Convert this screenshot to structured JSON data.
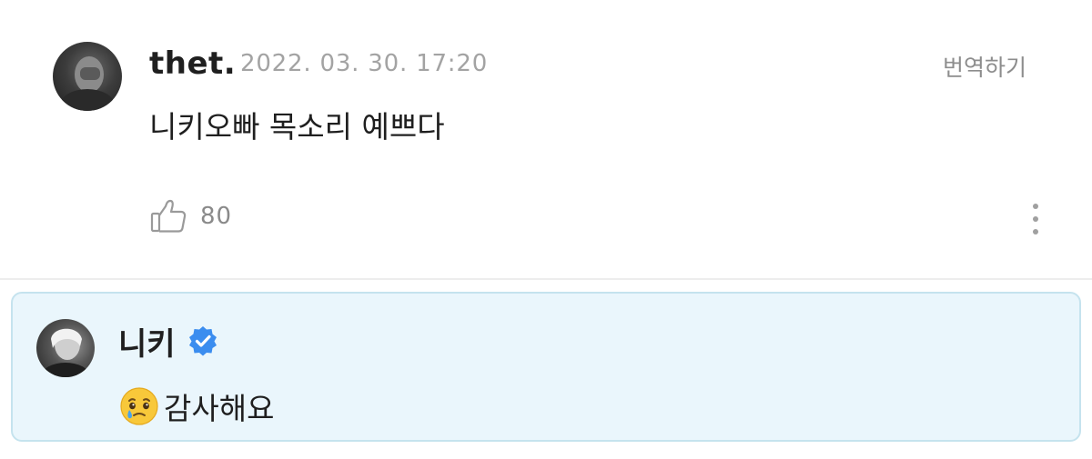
{
  "comment": {
    "author": "thet.",
    "date": "2022. 03. 30. 17:20",
    "translate_label": "번역하기",
    "text": "니키오빠 목소리 예쁘다",
    "like_count": "80",
    "avatar_icon": "user-avatar-photo",
    "like_icon": "thumbs-up-icon",
    "more_icon": "vertical-ellipsis-icon"
  },
  "reply": {
    "author": "니키",
    "verified_icon": "verified-badge-icon",
    "emoji_icon": "face-holding-back-tears-emoji",
    "text": "감사해요",
    "colors": {
      "background": "#eaf6fc",
      "border": "#c5e3ee",
      "verified": "#3b8def"
    }
  }
}
